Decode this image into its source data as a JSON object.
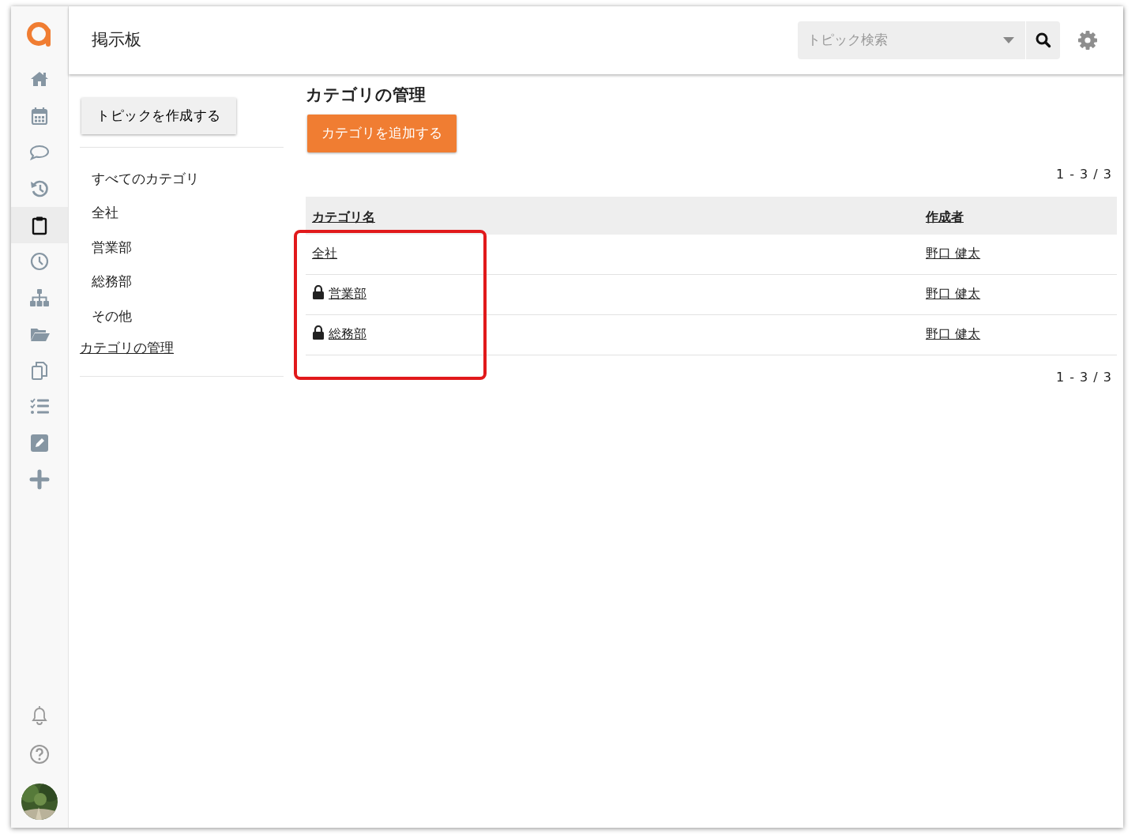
{
  "app": {
    "title": "掲示板"
  },
  "search": {
    "placeholder": "トピック検索"
  },
  "rail": [
    {
      "kind": "home",
      "selected": false
    },
    {
      "kind": "calendar",
      "selected": false
    },
    {
      "kind": "chat",
      "selected": false
    },
    {
      "kind": "history",
      "selected": false
    },
    {
      "kind": "clipboard",
      "selected": true
    },
    {
      "kind": "clock",
      "selected": false
    },
    {
      "kind": "sitemap",
      "selected": false
    },
    {
      "kind": "folder",
      "selected": false
    },
    {
      "kind": "copy",
      "selected": false
    },
    {
      "kind": "tasks",
      "selected": false
    },
    {
      "kind": "edit",
      "selected": false
    },
    {
      "kind": "plus",
      "selected": false
    }
  ],
  "rail_bottom": [
    {
      "kind": "bell"
    },
    {
      "kind": "help"
    }
  ],
  "sidebar": {
    "create_button": "トピックを作成する",
    "items": [
      {
        "label": "すべてのカテゴリ",
        "kind": "item"
      },
      {
        "label": "全社",
        "kind": "item"
      },
      {
        "label": "営業部",
        "kind": "item"
      },
      {
        "label": "総務部",
        "kind": "item"
      },
      {
        "label": "その他",
        "kind": "item"
      },
      {
        "label": "カテゴリの管理",
        "kind": "link"
      }
    ]
  },
  "content": {
    "heading": "カテゴリの管理",
    "add_button": "カテゴリを追加する",
    "pager_top": "1 - 3 / 3",
    "pager_bottom": "1 - 3 / 3",
    "table": {
      "columns": [
        "カテゴリ名",
        "作成者"
      ],
      "rows": [
        {
          "name": "全社",
          "locked": false,
          "creator": "野口 健太"
        },
        {
          "name": "営業部",
          "locked": true,
          "creator": "野口 健太"
        },
        {
          "name": "総務部",
          "locked": true,
          "creator": "野口 健太"
        }
      ]
    }
  }
}
